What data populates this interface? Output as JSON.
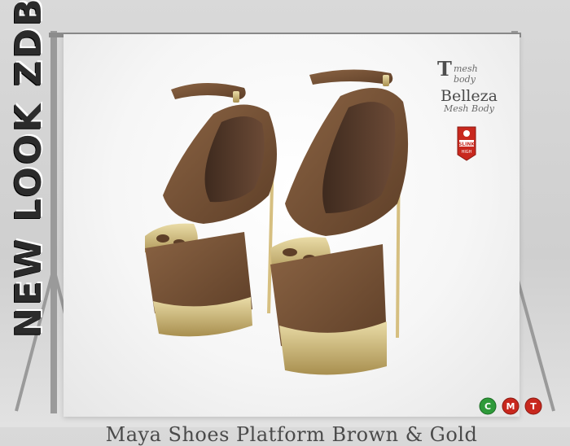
{
  "brand": {
    "text": "NEW LOOK ZDB"
  },
  "caption": {
    "text": "Maya Shoes Platform Brown & Gold"
  },
  "logos": {
    "tmesh": {
      "mark": "T",
      "text": "mesh body"
    },
    "belleza": {
      "main": "Belleza",
      "sub": "Mesh Body"
    },
    "slink": {
      "text": "SLINK",
      "sub": "HIGH"
    }
  },
  "permissions": [
    {
      "letter": "C",
      "color": "#2e9a3a",
      "icon": "copy-icon"
    },
    {
      "letter": "M",
      "color": "#c8281e",
      "icon": "modify-icon"
    },
    {
      "letter": "T",
      "color": "#c8281e",
      "icon": "transfer-icon"
    }
  ],
  "colors": {
    "suede": "#7a5538",
    "suede_dark": "#5e3f28",
    "gold": "#d6bf80",
    "gold_dark": "#a88f4f",
    "inner": "#4d3426"
  }
}
